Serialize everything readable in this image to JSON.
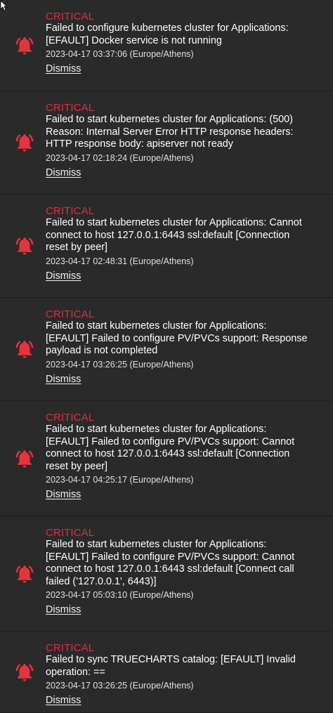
{
  "alerts": [
    {
      "level": "CRITICAL",
      "message": "Failed to configure kubernetes cluster for Applications:\n[EFAULT] Docker service is not running",
      "timestamp": "2023-04-17 03:37:06 (Europe/Athens)",
      "dismiss": "Dismiss",
      "icon": "alert-bell-icon"
    },
    {
      "level": "CRITICAL",
      "message": "Failed to start kubernetes cluster for Applications: (500)\nReason: Internal Server Error HTTP response headers:\nHTTP response body: apiserver not ready",
      "timestamp": "2023-04-17 02:18:24 (Europe/Athens)",
      "dismiss": "Dismiss",
      "icon": "alert-bell-icon"
    },
    {
      "level": "CRITICAL",
      "message": "Failed to start kubernetes cluster for Applications: Cannot\nconnect to host 127.0.0.1:6443 ssl:default [Connection\nreset by peer]",
      "timestamp": "2023-04-17 02:48:31 (Europe/Athens)",
      "dismiss": "Dismiss",
      "icon": "alert-bell-icon"
    },
    {
      "level": "CRITICAL",
      "message": "Failed to start kubernetes cluster for Applications:\n[EFAULT] Failed to configure PV/PVCs support: Response\npayload is not completed",
      "timestamp": "2023-04-17 03:26:25 (Europe/Athens)",
      "dismiss": "Dismiss",
      "icon": "alert-bell-icon"
    },
    {
      "level": "CRITICAL",
      "message": "Failed to start kubernetes cluster for Applications:\n[EFAULT] Failed to configure PV/PVCs support: Cannot\nconnect to host 127.0.0.1:6443 ssl:default [Connection\nreset by peer]",
      "timestamp": "2023-04-17 04:25:17 (Europe/Athens)",
      "dismiss": "Dismiss",
      "icon": "alert-bell-icon"
    },
    {
      "level": "CRITICAL",
      "message": "Failed to start kubernetes cluster for Applications:\n[EFAULT] Failed to configure PV/PVCs support: Cannot\nconnect to host 127.0.0.1:6443 ssl:default [Connect call\nfailed ('127.0.0.1', 6443)]",
      "timestamp": "2023-04-17 05:03:10 (Europe/Athens)",
      "dismiss": "Dismiss",
      "icon": "alert-bell-icon"
    },
    {
      "level": "CRITICAL",
      "message": "Failed to sync TRUECHARTS catalog: [EFAULT] Invalid\noperation: ==",
      "timestamp": "2023-04-17 03:26:25 (Europe/Athens)",
      "dismiss": "Dismiss",
      "icon": "alert-bell-icon"
    }
  ],
  "colors": {
    "critical": "#d9323c",
    "background": "#292929",
    "icon": "#e8333b"
  }
}
